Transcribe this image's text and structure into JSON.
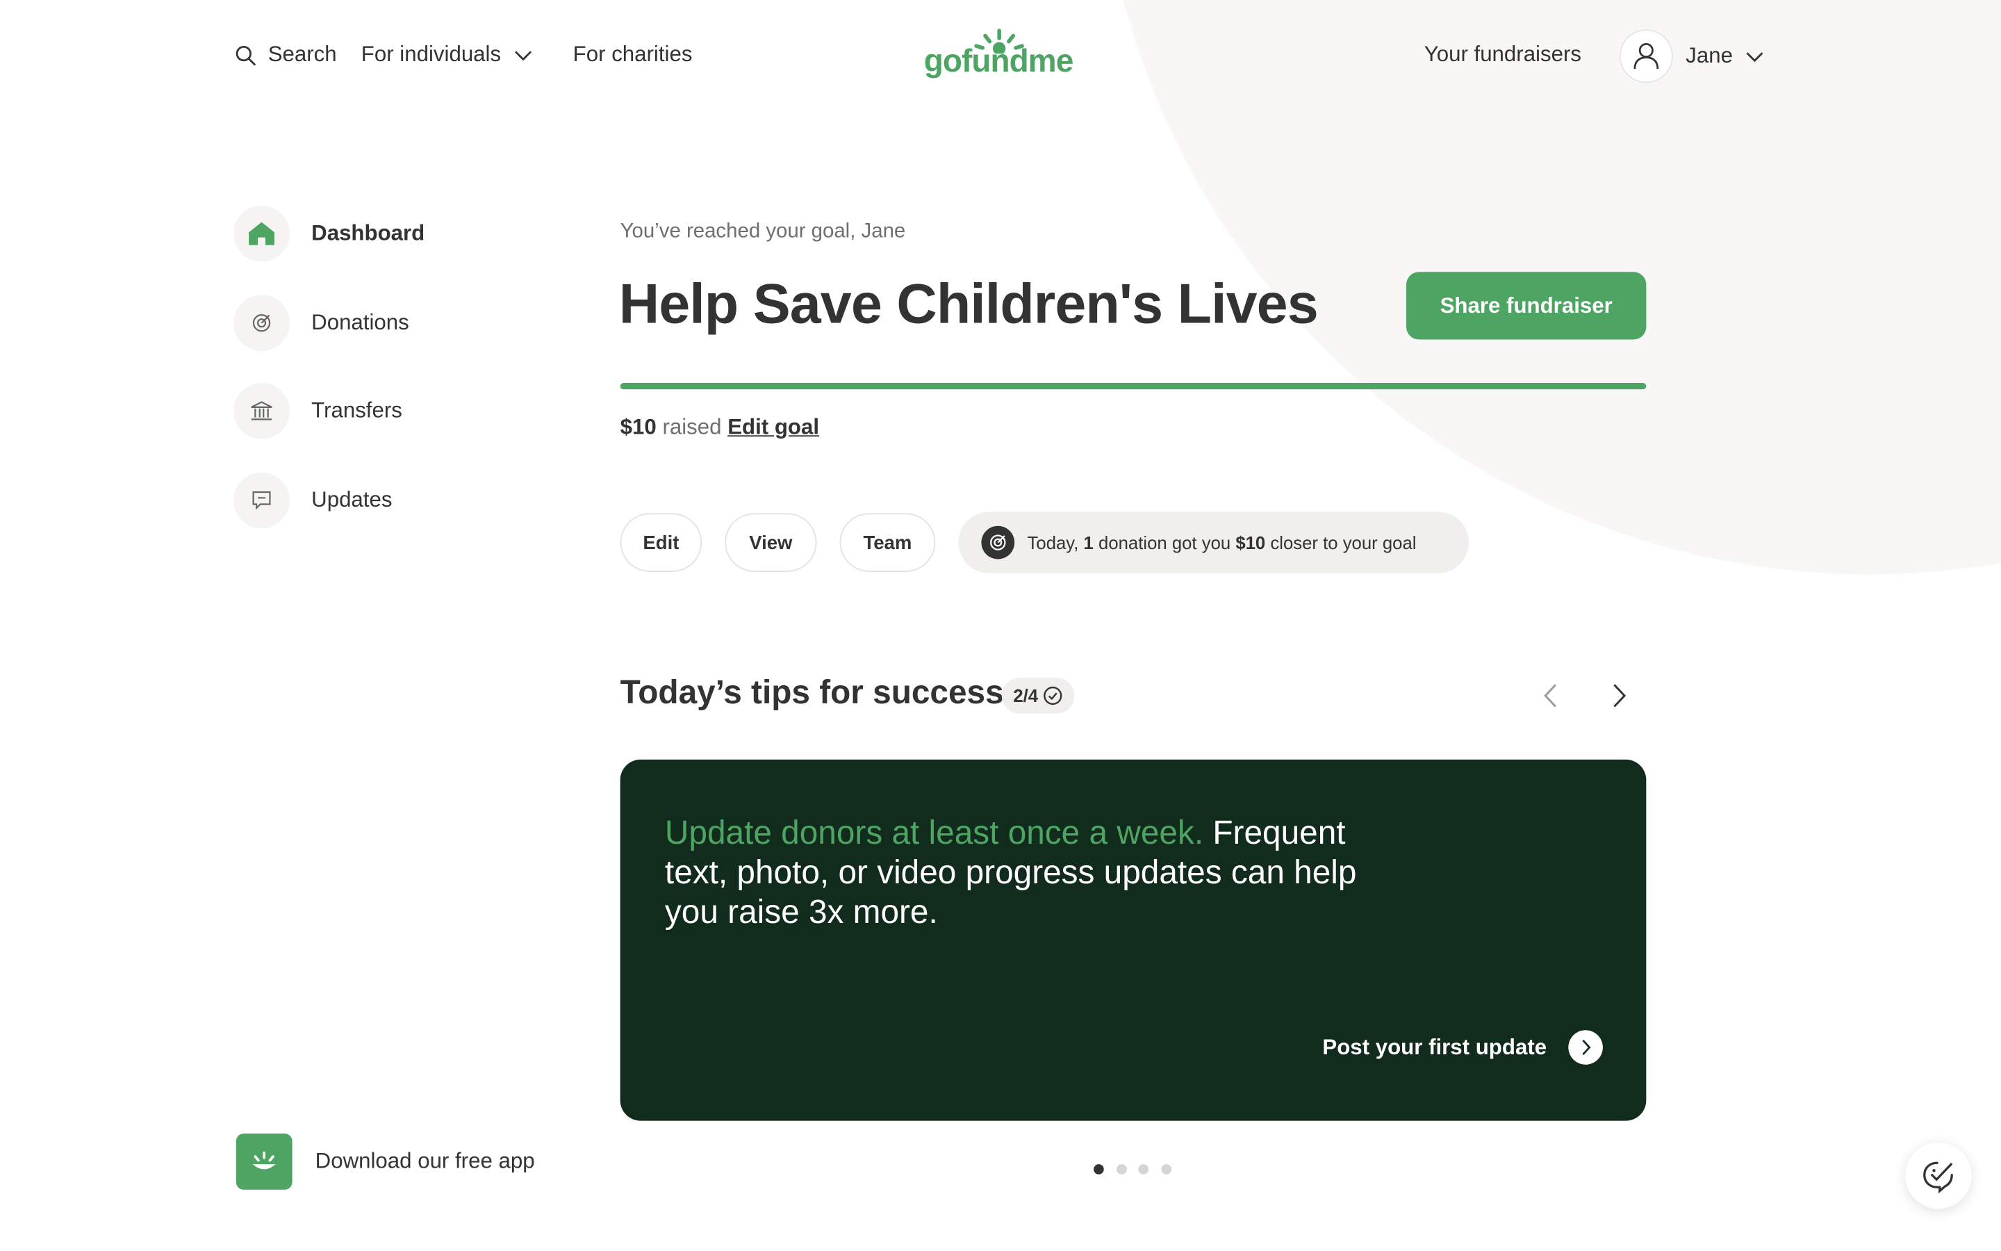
{
  "header": {
    "search_label": "Search",
    "individuals_label": "For individuals",
    "charities_label": "For charities",
    "logo_text": "gofundme",
    "your_fundraisers_label": "Your fundraisers",
    "user_name": "Jane"
  },
  "sidebar": {
    "items": [
      {
        "label": "Dashboard",
        "icon": "home-icon",
        "active": true
      },
      {
        "label": "Donations",
        "icon": "donation-target-icon",
        "active": false
      },
      {
        "label": "Transfers",
        "icon": "bank-icon",
        "active": false
      },
      {
        "label": "Updates",
        "icon": "message-icon",
        "active": false
      }
    ],
    "app_download_label": "Download our free app"
  },
  "main": {
    "greeting": "You’ve reached your goal, Jane",
    "title": "Help Save Children's Lives",
    "share_label": "Share fundraiser",
    "progress_percent": 100,
    "raised_amount": "$10",
    "raised_word": "raised",
    "edit_goal_label": "Edit goal",
    "actions": [
      "Edit",
      "View",
      "Team"
    ],
    "today": {
      "prefix": "Today,",
      "count": "1",
      "middle": "donation got you",
      "amount": "$10",
      "suffix": "closer to your goal"
    }
  },
  "tips": {
    "title": "Today’s tips for success",
    "progress": "2/4",
    "card": {
      "highlight": "Update donors at least once a week.",
      "body": "Frequent text, photo, or video progress updates can help you raise 3x more.",
      "cta_label": "Post your first update"
    },
    "dot_count": 4,
    "active_dot": 0
  },
  "colors": {
    "brand_green": "#4ea463",
    "card_dark_green": "#112c1c",
    "text_primary": "#333333"
  }
}
